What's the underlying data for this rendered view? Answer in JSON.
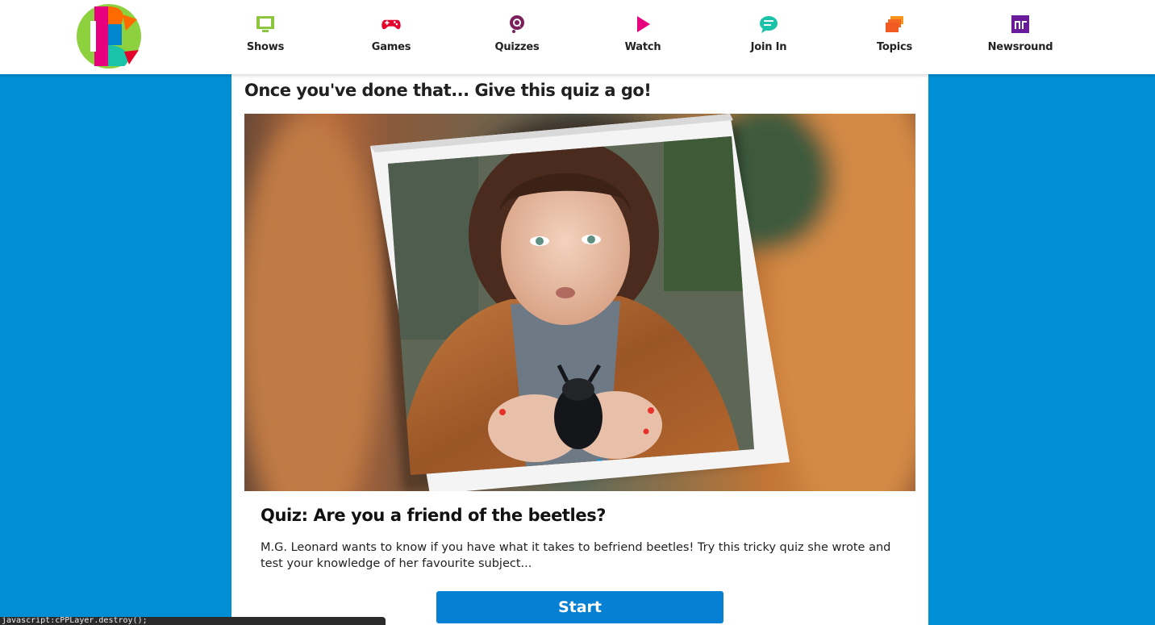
{
  "header": {
    "logo_name": "CBBC",
    "nav": [
      {
        "id": "shows",
        "label": "Shows",
        "icon": "tv-icon",
        "color": "#8cc63f"
      },
      {
        "id": "games",
        "label": "Games",
        "icon": "gamepad-icon",
        "color": "#e4002b"
      },
      {
        "id": "quizzes",
        "label": "Quizzes",
        "icon": "quiz-bubble-icon",
        "color": "#7a1f5c"
      },
      {
        "id": "watch",
        "label": "Watch",
        "icon": "play-icon",
        "color": "#e6007e"
      },
      {
        "id": "join-in",
        "label": "Join In",
        "icon": "chat-bubble-icon",
        "color": "#19c3a9"
      },
      {
        "id": "topics",
        "label": "Topics",
        "icon": "stacked-cards-icon",
        "color": "#f26522"
      },
      {
        "id": "newsround",
        "label": "Newsround",
        "icon": "newsround-icon",
        "color": "#6a1b9a"
      }
    ]
  },
  "main": {
    "heading": "Once you've done that... Give this quiz a go!",
    "quiz": {
      "title": "Quiz: Are you a friend of the beetles?",
      "description": "M.G. Leonard wants to know if you have what it takes to befriend beetles! Try this tricky quiz she wrote and test your knowledge of her favourite subject...",
      "start_label": "Start"
    }
  },
  "status_bar": {
    "text": "javascript:cPPLayer.destroy();"
  },
  "colors": {
    "page_background": "#008fd5",
    "button": "#0580d2",
    "content_background": "#ffffff"
  }
}
